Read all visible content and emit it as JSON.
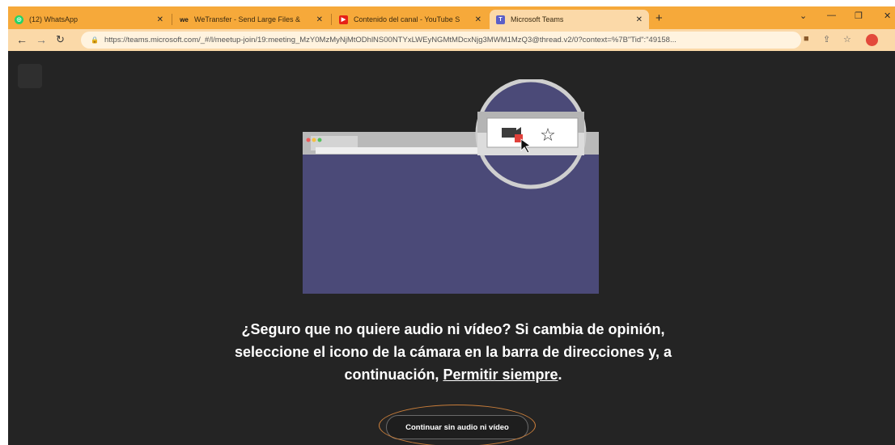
{
  "browser": {
    "tabs": [
      {
        "title": "(12) WhatsApp",
        "favicon": "whatsapp-icon",
        "favicon_color": "#25D366",
        "favicon_glyph": "◎",
        "active": false
      },
      {
        "title": "WeTransfer - Send Large Files &",
        "favicon": "wetransfer-icon",
        "favicon_color": "#1a1a1a",
        "favicon_glyph": "we",
        "active": false
      },
      {
        "title": "Contenido del canal - YouTube S",
        "favicon": "youtube-icon",
        "favicon_color": "#e62117",
        "favicon_glyph": "▶",
        "active": false
      },
      {
        "title": "Microsoft Teams",
        "favicon": "teams-icon",
        "favicon_color": "#5b5fc7",
        "favicon_glyph": "T",
        "active": true
      }
    ],
    "new_tab": "+",
    "url": "https://teams.microsoft.com/_#/l/meetup-join/19:meeting_MzY0MzMyNjMtODhlNS00NTYxLWEyNGMtMDcxNjg3MWM1MzQ3@thread.v2/0?context=%7B\"Tid\":\"49158...",
    "accent_color": "#f6a93a"
  },
  "page": {
    "prompt_text": "¿Seguro que no quiere audio ni vídeo? Si cambia de opinión, seleccione el icono de la cámara en la barra de direcciones y, a continuación, ",
    "prompt_link": "Permitir siempre",
    "prompt_end": ".",
    "continue_button": "Continuar sin audio ni vídeo"
  }
}
